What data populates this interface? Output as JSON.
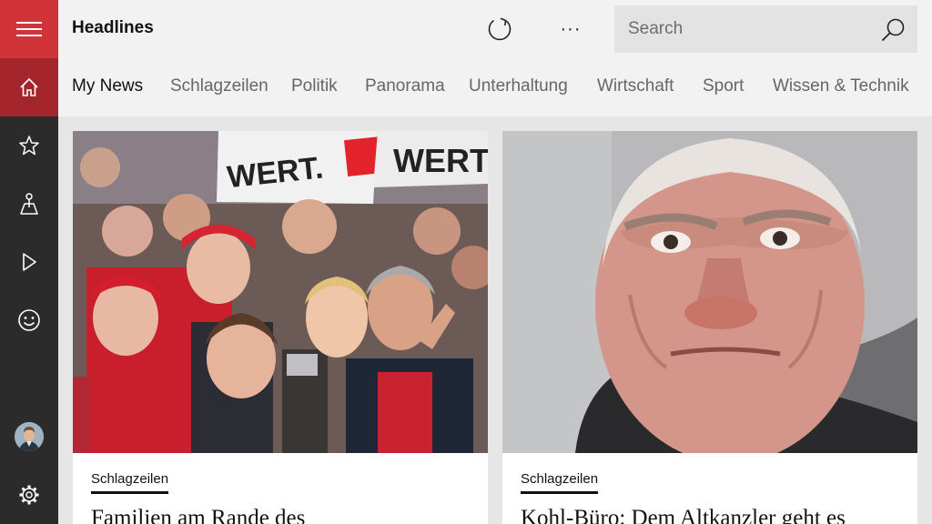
{
  "app": {
    "title": "Headlines"
  },
  "sidebar": {
    "items": [
      {
        "name": "menu",
        "icon": "hamburger-icon"
      },
      {
        "name": "home",
        "icon": "home-icon",
        "active": true
      },
      {
        "name": "favorites",
        "icon": "star-icon"
      },
      {
        "name": "local",
        "icon": "local-icon"
      },
      {
        "name": "video",
        "icon": "play-icon"
      },
      {
        "name": "entertainment",
        "icon": "smiley-icon"
      },
      {
        "name": "profile",
        "icon": "avatar"
      },
      {
        "name": "settings",
        "icon": "gear-icon"
      }
    ],
    "accent_color": "#d13438",
    "active_color": "#a4262c"
  },
  "toolbar": {
    "more_label": "···"
  },
  "search": {
    "placeholder": "Search"
  },
  "tabs": [
    {
      "label": "My News",
      "active": true
    },
    {
      "label": "Schlagzeilen"
    },
    {
      "label": "Politik"
    },
    {
      "label": "Panorama"
    },
    {
      "label": "Unterhaltung"
    },
    {
      "label": "Wirtschaft"
    },
    {
      "label": "Sport"
    },
    {
      "label": "Wissen & Technik"
    }
  ],
  "articles": [
    {
      "category": "Schlagzeilen",
      "headline": "Familien am Rande des",
      "image": "protest-crowd-photo"
    },
    {
      "category": "Schlagzeilen",
      "headline": "Kohl-Büro: Dem Altkanzler geht es",
      "image": "elderly-man-portrait-photo"
    }
  ]
}
